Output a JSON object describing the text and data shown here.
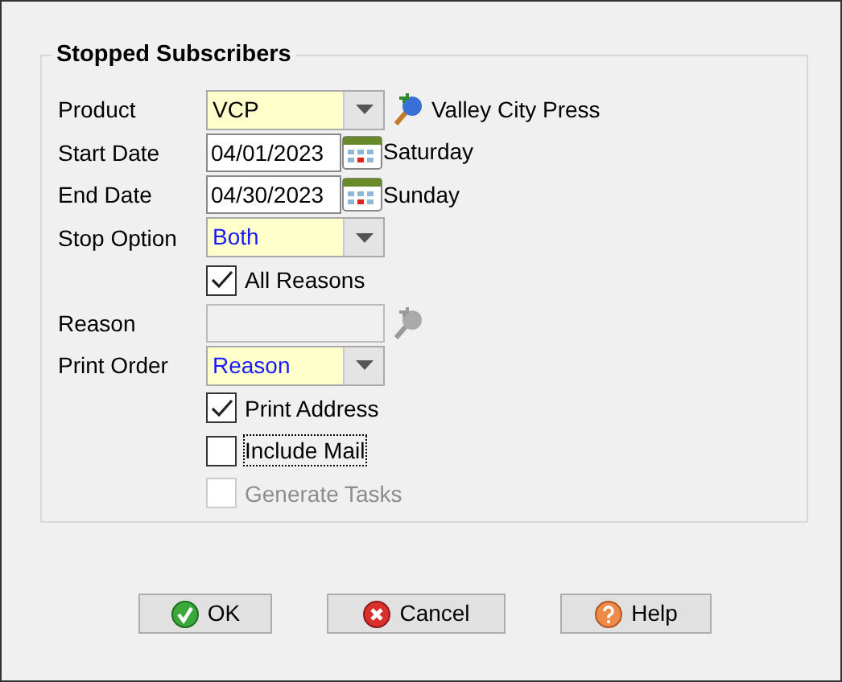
{
  "group": {
    "title": "Stopped Subscribers"
  },
  "rows": [
    {
      "kind": "combo",
      "label": "Product",
      "value": "VCP",
      "color": "#000000",
      "lookup": true,
      "description": "Valley City Press"
    },
    {
      "kind": "date",
      "label": "Start Date",
      "value": "04/01/2023",
      "day": "Saturday"
    },
    {
      "kind": "date",
      "label": "End Date",
      "value": "04/30/2023",
      "day": "Sunday"
    },
    {
      "kind": "combo",
      "label": "Stop Option",
      "value": "Both",
      "color": "#1a1aff",
      "lookup": false
    },
    {
      "kind": "check",
      "label": "All Reasons",
      "checked": true,
      "disabled": false,
      "focused": false
    },
    {
      "kind": "lookup",
      "label": "Reason",
      "disabled": true
    },
    {
      "kind": "combo",
      "label": "Print Order",
      "value": "Reason",
      "color": "#1a1aff",
      "lookup": false
    },
    {
      "kind": "check",
      "label": "Print Address",
      "checked": true,
      "disabled": false,
      "focused": false
    },
    {
      "kind": "check",
      "label": "Include Mail",
      "checked": false,
      "disabled": false,
      "focused": true
    },
    {
      "kind": "check",
      "label": "Generate Tasks",
      "checked": false,
      "disabled": true,
      "focused": false
    }
  ],
  "buttons": [
    {
      "kind": "ok",
      "label": "OK"
    },
    {
      "kind": "cancel",
      "label": "Cancel"
    },
    {
      "kind": "help",
      "label": "Help"
    }
  ]
}
